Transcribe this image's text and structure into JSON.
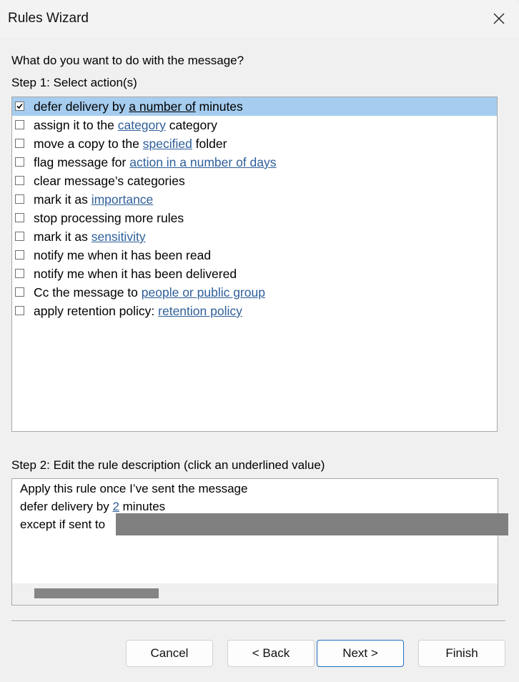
{
  "window": {
    "title": "Rules Wizard",
    "close_icon": "close-x-icon"
  },
  "prompt": "What do you want to do with the message?",
  "step1": {
    "label": "Step 1: Select action(s)",
    "actions": [
      {
        "checked": true,
        "selected": true,
        "parts": [
          {
            "t": "defer delivery by "
          },
          {
            "t": "a number of",
            "link": true
          },
          {
            "t": " minutes"
          }
        ]
      },
      {
        "checked": false,
        "parts": [
          {
            "t": "assign it to the "
          },
          {
            "t": "category",
            "link": true
          },
          {
            "t": " category"
          }
        ]
      },
      {
        "checked": false,
        "parts": [
          {
            "t": "move a copy to the "
          },
          {
            "t": "specified",
            "link": true
          },
          {
            "t": " folder"
          }
        ]
      },
      {
        "checked": false,
        "parts": [
          {
            "t": "flag message for "
          },
          {
            "t": "action in a number of days",
            "link": true
          }
        ]
      },
      {
        "checked": false,
        "parts": [
          {
            "t": "clear message’s categories"
          }
        ]
      },
      {
        "checked": false,
        "parts": [
          {
            "t": "mark it as "
          },
          {
            "t": "importance",
            "link": true
          }
        ]
      },
      {
        "checked": false,
        "parts": [
          {
            "t": "stop processing more rules"
          }
        ]
      },
      {
        "checked": false,
        "parts": [
          {
            "t": "mark it as "
          },
          {
            "t": "sensitivity",
            "link": true
          }
        ]
      },
      {
        "checked": false,
        "parts": [
          {
            "t": "notify me when it has been read"
          }
        ]
      },
      {
        "checked": false,
        "parts": [
          {
            "t": "notify me when it has been delivered"
          }
        ]
      },
      {
        "checked": false,
        "parts": [
          {
            "t": "Cc the message to "
          },
          {
            "t": "people or public group",
            "link": true
          }
        ]
      },
      {
        "checked": false,
        "parts": [
          {
            "t": "apply retention policy: "
          },
          {
            "t": "retention policy",
            "link": true
          }
        ]
      }
    ]
  },
  "step2": {
    "label": "Step 2: Edit the rule description (click an underlined value)",
    "line1": "Apply this rule once I’ve sent the message",
    "line2_prefix": "defer delivery by ",
    "line2_value": "2",
    "line2_suffix": " minutes",
    "line3": "except if sent to"
  },
  "buttons": {
    "cancel": "Cancel",
    "back": "< Back",
    "next": "Next >",
    "finish": "Finish"
  },
  "colors": {
    "selection": "#a6cdef",
    "link": "#2e5f9a",
    "default_button_border": "#1f6fbf"
  }
}
